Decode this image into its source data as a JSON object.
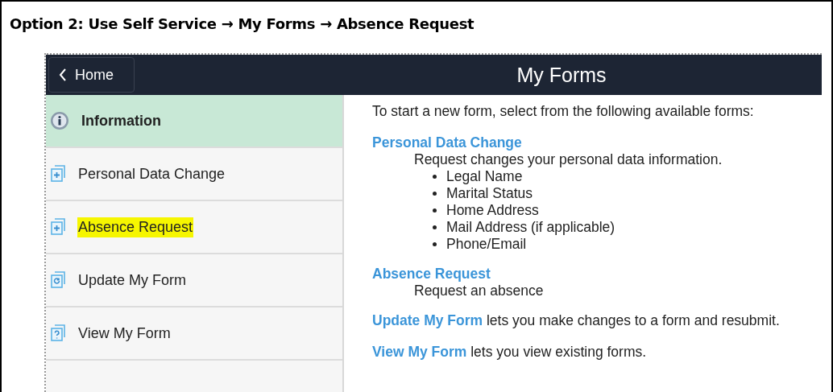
{
  "caption": "Option 2: Use Self Service → My Forms → Absence Request",
  "header": {
    "back_button": "Home",
    "title": "My Forms"
  },
  "sidebar": {
    "items": [
      {
        "label": "Information",
        "kind": "info",
        "selected": true,
        "highlighted": false
      },
      {
        "label": "Personal Data Change",
        "kind": "add",
        "selected": false,
        "highlighted": false
      },
      {
        "label": "Absence Request",
        "kind": "add",
        "selected": false,
        "highlighted": true
      },
      {
        "label": "Update My Form",
        "kind": "update",
        "selected": false,
        "highlighted": false
      },
      {
        "label": "View My Form",
        "kind": "view",
        "selected": false,
        "highlighted": false
      }
    ]
  },
  "content": {
    "intro": "To start a new form, select from the following available forms:",
    "forms": [
      {
        "link": "Personal Data Change",
        "description": "Request changes your personal data information.",
        "bullets": [
          "Legal Name",
          "Marital Status",
          "Home Address",
          "Mail Address (if applicable)",
          "Phone/Email"
        ]
      },
      {
        "link": "Absence Request",
        "description": "Request an absence"
      }
    ],
    "sentences": [
      {
        "link": "Update My Form",
        "text": "lets you make changes to a form and resubmit."
      },
      {
        "link": "View My Form",
        "text": "lets you view existing forms."
      }
    ]
  }
}
